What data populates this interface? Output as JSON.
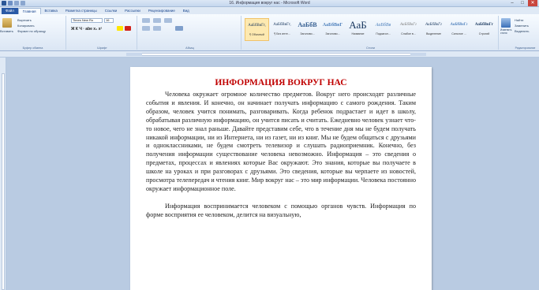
{
  "window": {
    "title": "16. Информация вокруг нас - Microsoft Word",
    "controls": [
      "–",
      "□",
      "✕"
    ]
  },
  "ribbon_tabs": [
    "Файл",
    "Главная",
    "Вставка",
    "Разметка страницы",
    "Ссылки",
    "Рассылки",
    "Рецензирование",
    "Вид"
  ],
  "clipboard": {
    "paste_label": "Вставить",
    "cut_label": "Вырезать",
    "copy_label": "Копировать",
    "format_painter_label": "Формат по образцу",
    "group_label": "Буфер обмена"
  },
  "font": {
    "font_name": "Times New Ro",
    "font_size": "16",
    "format_row": "Ж  К  Ч  ·  abe  x₂  x²",
    "group_label": "Шрифт"
  },
  "paragraph": {
    "group_label": "Абзац"
  },
  "styles": {
    "items": [
      {
        "sample": "АаБбВвГг,",
        "name": "¶ Обычный"
      },
      {
        "sample": "АаБбВвГг,",
        "name": "¶ Без инте..."
      },
      {
        "sample": "АаБбВ",
        "name": "Заголово..."
      },
      {
        "sample": "АаБбВвГ",
        "name": "Заголово..."
      },
      {
        "sample": "АаБ",
        "name": "Название"
      },
      {
        "sample": "АаБбВв",
        "name": "Подзагол..."
      },
      {
        "sample": "АаБбВвГг",
        "name": "Слабое в..."
      },
      {
        "sample": "АаБбВвГг",
        "name": "Выделение"
      },
      {
        "sample": "АаБбВвГг",
        "name": "Сильное ..."
      },
      {
        "sample": "АаБбВвГг",
        "name": "Строгий"
      }
    ],
    "change_styles_label": "Изменить стили",
    "group_label": "Стили"
  },
  "editing": {
    "find_label": "Найти",
    "replace_label": "Заменить",
    "select_label": "Выделить",
    "group_label": "Редактирование"
  },
  "document": {
    "title": "ИНФОРМАЦИЯ ВОКРУГ НАС",
    "paragraphs": [
      "Человека окружает огромное количество предметов. Вокруг него происходят различные события и явления. И конечно, он начинает получать информацию с самого рождения. Таким образом, человек учится понимать, разговаривать. Когда ребенок подрастает и идет в школу, обрабатывая различную информацию, он учится писать и считать. Ежедневно человек узнает что-то новое, чего не знал раньше. Давайте представим себе, что в течение дня мы не будем получать никакой информации, ни из Интернета, ни из газет, ни из книг. Мы не будем общаться с друзьями и одноклассниками, не будем смотреть телевизор и слушать радиоприемник. Конечно, без получения информации существование человека невозможно. Информация – это сведения о предметах, процессах и явлениях которые Вас окружают. Это знания, которые вы получаете в школе на уроках и при разговорах с друзьями. Это сведения, которые вы черпаете из новостей, просмотра телепередач и чтения книг. Мир вокруг нас – это мир информации. Человека постоянно окружает информационное поле.",
      "Информация воспринимается человеком с помощью органов чувств. Информация по форме восприятия ее человеком, делится на визуальную,"
    ]
  },
  "colors": {
    "title_red": "#c00000",
    "ribbon_blue": "#2a5aa6"
  }
}
